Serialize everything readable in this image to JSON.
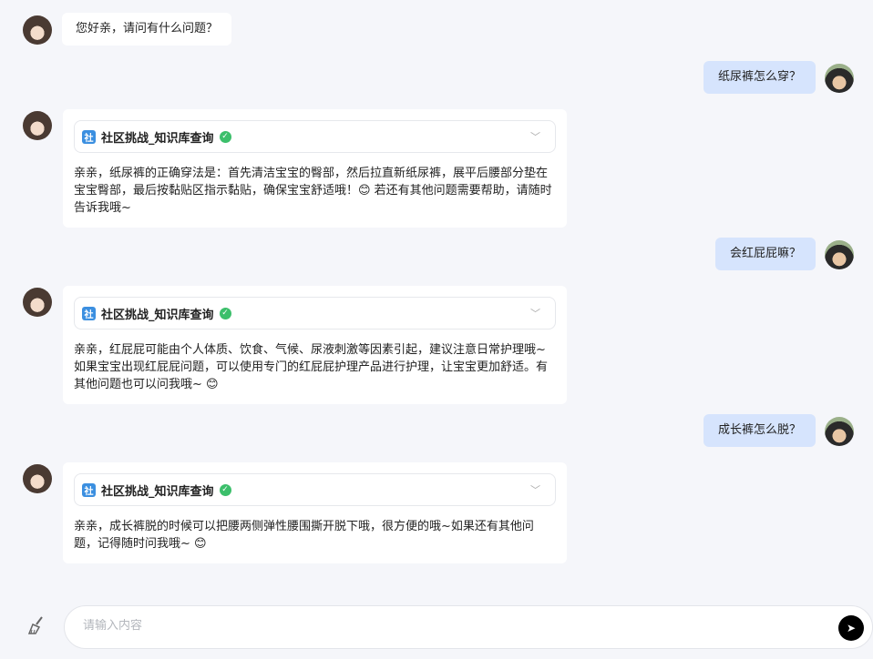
{
  "messages": [
    {
      "role": "bot",
      "text": "您好亲，请问有什么问题？"
    },
    {
      "role": "user",
      "text": "纸尿裤怎么穿？"
    },
    {
      "role": "bot",
      "tool": "社区挑战_知识库查询",
      "tool_badge": "社",
      "text": "亲亲，纸尿裤的正确穿法是：首先清洁宝宝的臀部，然后拉直新纸尿裤，展平后腰部分垫在宝宝臀部，最后按黏贴区指示黏贴，确保宝宝舒适哦！😊 若还有其他问题需要帮助，请随时告诉我哦~"
    },
    {
      "role": "user",
      "text": "会红屁屁嘛？"
    },
    {
      "role": "bot",
      "tool": "社区挑战_知识库查询",
      "tool_badge": "社",
      "text": "亲亲，红屁屁可能由个人体质、饮食、气候、尿液刺激等因素引起，建议注意日常护理哦~如果宝宝出现红屁屁问题，可以使用专门的红屁屁护理产品进行护理，让宝宝更加舒适。有其他问题也可以问我哦~ 😊"
    },
    {
      "role": "user",
      "text": "成长裤怎么脱？"
    },
    {
      "role": "bot",
      "tool": "社区挑战_知识库查询",
      "tool_badge": "社",
      "text": "亲亲，成长裤脱的时候可以把腰两侧弹性腰围撕开脱下哦，很方便的哦~如果还有其他问题，记得随时问我哦~ 😊"
    }
  ],
  "input": {
    "placeholder": "请输入内容",
    "value": ""
  }
}
